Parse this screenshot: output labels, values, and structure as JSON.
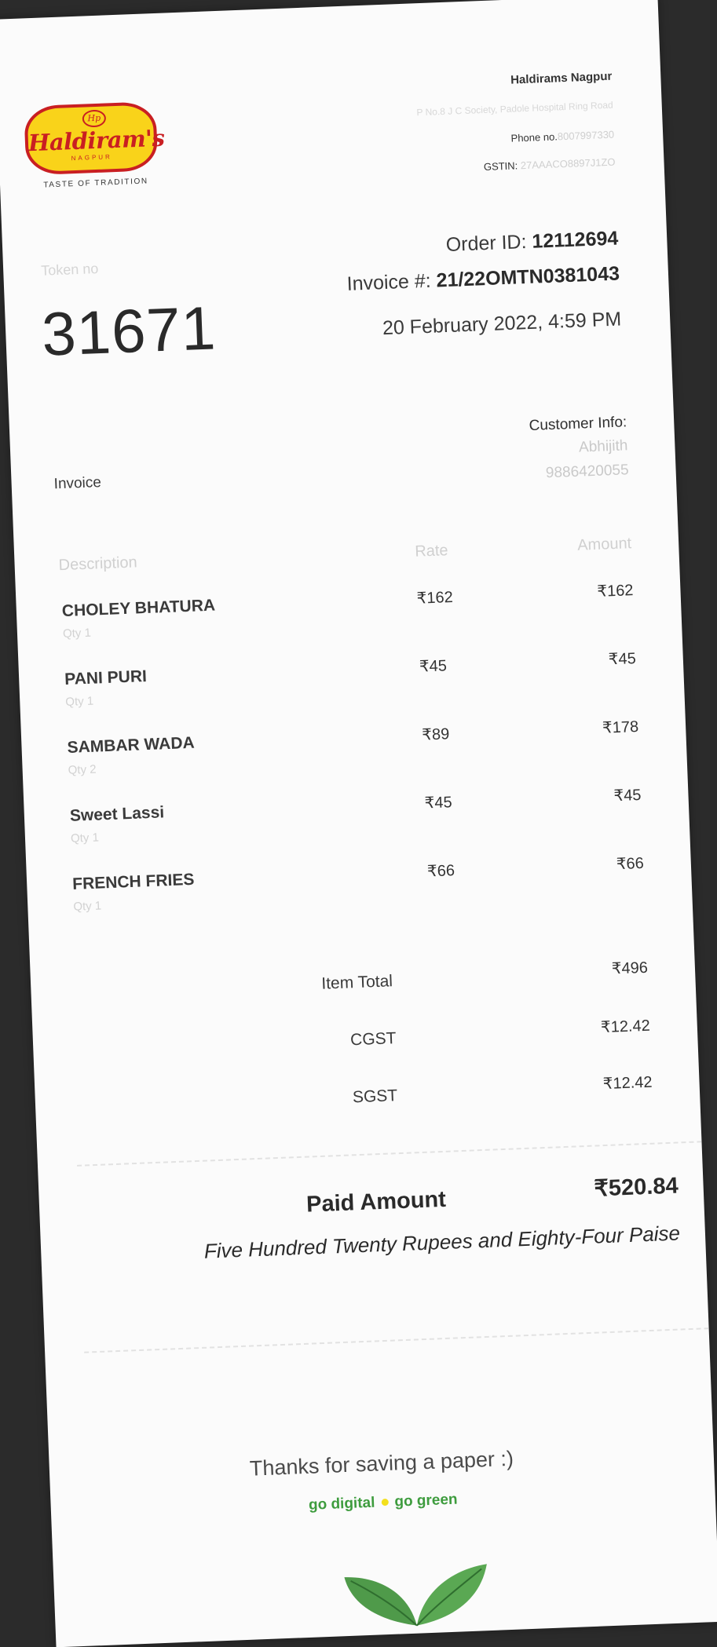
{
  "store": {
    "logo_text": "Haldiram's",
    "logo_sub": "NAGPUR",
    "logo_mono": "Hp",
    "logo_tagline": "TASTE OF TRADITION",
    "name": "Haldirams Nagpur",
    "address": "P No.8 J C Society, Padole Hospital Ring Road",
    "phone_label": "Phone no.",
    "phone_value": "8007997330",
    "gstin_label": "GSTIN:",
    "gstin_value": "27AAACO8897J1ZO"
  },
  "token": {
    "label": "Token no",
    "number": "31671"
  },
  "order": {
    "order_label": "Order ID:",
    "order_id": "12112694",
    "invoice_label": "Invoice #:",
    "invoice_no": "21/22OMTN0381043",
    "date": "20 February 2022, 4:59 PM"
  },
  "customer": {
    "label": "Customer Info:",
    "name": "Abhijith",
    "phone": "9886420055"
  },
  "invoice_title": "Invoice",
  "columns": {
    "description": "Description",
    "rate": "Rate",
    "amount": "Amount"
  },
  "items": [
    {
      "name": "CHOLEY BHATURA",
      "qty": "Qty 1",
      "rate": "₹162",
      "amount": "₹162"
    },
    {
      "name": "PANI PURI",
      "qty": "Qty 1",
      "rate": "₹45",
      "amount": "₹45"
    },
    {
      "name": "SAMBAR WADA",
      "qty": "Qty 2",
      "rate": "₹89",
      "amount": "₹178"
    },
    {
      "name": "Sweet Lassi",
      "qty": "Qty 1",
      "rate": "₹45",
      "amount": "₹45"
    },
    {
      "name": "FRENCH FRIES",
      "qty": "Qty 1",
      "rate": "₹66",
      "amount": "₹66"
    }
  ],
  "totals": {
    "item_total_label": "Item Total",
    "item_total": "₹496",
    "cgst_label": "CGST",
    "cgst": "₹12.42",
    "sgst_label": "SGST",
    "sgst": "₹12.42"
  },
  "paid": {
    "label": "Paid Amount",
    "amount": "₹520.84",
    "words": "Five Hundred Twenty Rupees and Eighty-Four Paise"
  },
  "footer": {
    "thanks": "Thanks for saving a paper :)",
    "go_digital": "go digital",
    "go_green": "go green"
  },
  "colors": {
    "brand_red": "#c91f22",
    "brand_yellow": "#f9d31a",
    "green": "#3e9c3e"
  }
}
